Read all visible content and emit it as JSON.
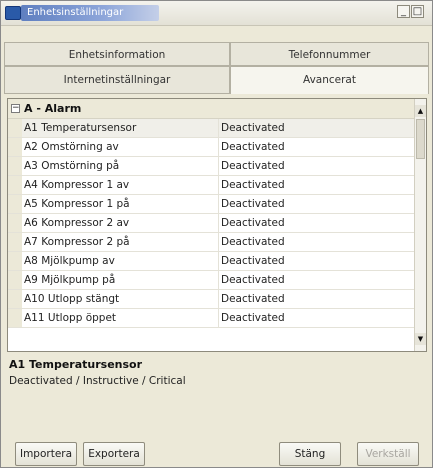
{
  "window": {
    "title": "Enhetsinställningar",
    "minimize_glyph": "_",
    "maximize_glyph": "□"
  },
  "tabs": [
    {
      "label": "Enhetsinformation",
      "active": false
    },
    {
      "label": "Telefonnummer",
      "active": false
    },
    {
      "label": "Internetinställningar",
      "active": false
    },
    {
      "label": "Avancerat",
      "active": true
    }
  ],
  "grid": {
    "group": {
      "expander": "−",
      "label": "A - Alarm"
    },
    "rows": [
      {
        "name": "A1 Temperatursensor",
        "value": "Deactivated",
        "selected": true
      },
      {
        "name": "A2 Omstörning av",
        "value": "Deactivated"
      },
      {
        "name": "A3 Omstörning på",
        "value": "Deactivated"
      },
      {
        "name": "A4 Kompressor 1 av",
        "value": "Deactivated"
      },
      {
        "name": "A5 Kompressor 1 på",
        "value": "Deactivated"
      },
      {
        "name": "A6 Kompressor 2 av",
        "value": "Deactivated"
      },
      {
        "name": "A7 Kompressor 2 på",
        "value": "Deactivated"
      },
      {
        "name": "A8 Mjölkpump av",
        "value": "Deactivated"
      },
      {
        "name": "A9 Mjölkpump på",
        "value": "Deactivated"
      },
      {
        "name": "A10 Utlopp stängt",
        "value": "Deactivated"
      },
      {
        "name": "A11 Utlopp öppet",
        "value": "Deactivated"
      }
    ],
    "scroll": {
      "up_glyph": "▲",
      "down_glyph": "▼"
    }
  },
  "description": {
    "title": "A1 Temperatursensor",
    "text": "Deactivated / Instructive / Critical"
  },
  "buttons": {
    "import": "Importera",
    "export": "Exportera",
    "close": "Stäng",
    "apply": "Verkställ"
  },
  "icons": {
    "app": "app-icon"
  }
}
